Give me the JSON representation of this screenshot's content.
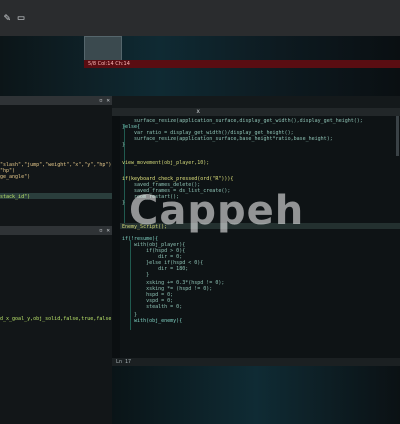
{
  "topbar": {
    "icons": [
      "tool-icon",
      "monitor-icon"
    ]
  },
  "status_bar": {
    "text": "5/8 Col:14 Ch:14"
  },
  "left_code": {
    "lines": [
      "\"slash\",\"jump\",\"weight\",\"x\",\"y\",\"hp\")",
      "\"hp\")",
      "ge_angle\")",
      "",
      "stack_id\")"
    ],
    "bottom_line": "d_x_goal_y,obj_solid,false,true,false)"
  },
  "editor": {
    "close_label": "x",
    "status": "Ln 17",
    "lines": [
      "    surface_resize(application_surface,display_get_width(),display_get_height();",
      "}else{",
      "    var ratio = display_get_width()/display_get_height();",
      "    surface_resize(application_surface,base_height*ratio,base_height);",
      "}",
      "",
      "view_movement(obj_player,10);",
      "",
      "if(keyboard_check_pressed(ord(\"R\"))){",
      "    saved_frames_delete();",
      "    saved_frames = ds_list_create();",
      "    room_restart();",
      "}",
      "",
      "Enemy_Script();",
      "",
      "if(!resume){",
      "    with(obj_player){",
      "        if(hspd > 0){",
      "            dir = 0;",
      "        }else if(hspd < 0){",
      "            dir = 180;",
      "        }",
      "        xsking += 0.3*(hspd != 0);",
      "        xsking *= (hspd != 0);",
      "        hspd = 0;",
      "        vspd = 0;",
      "        stealth = 0;",
      "    }",
      "    with(obj_enemy){"
    ]
  },
  "watermark": "Cappeh"
}
